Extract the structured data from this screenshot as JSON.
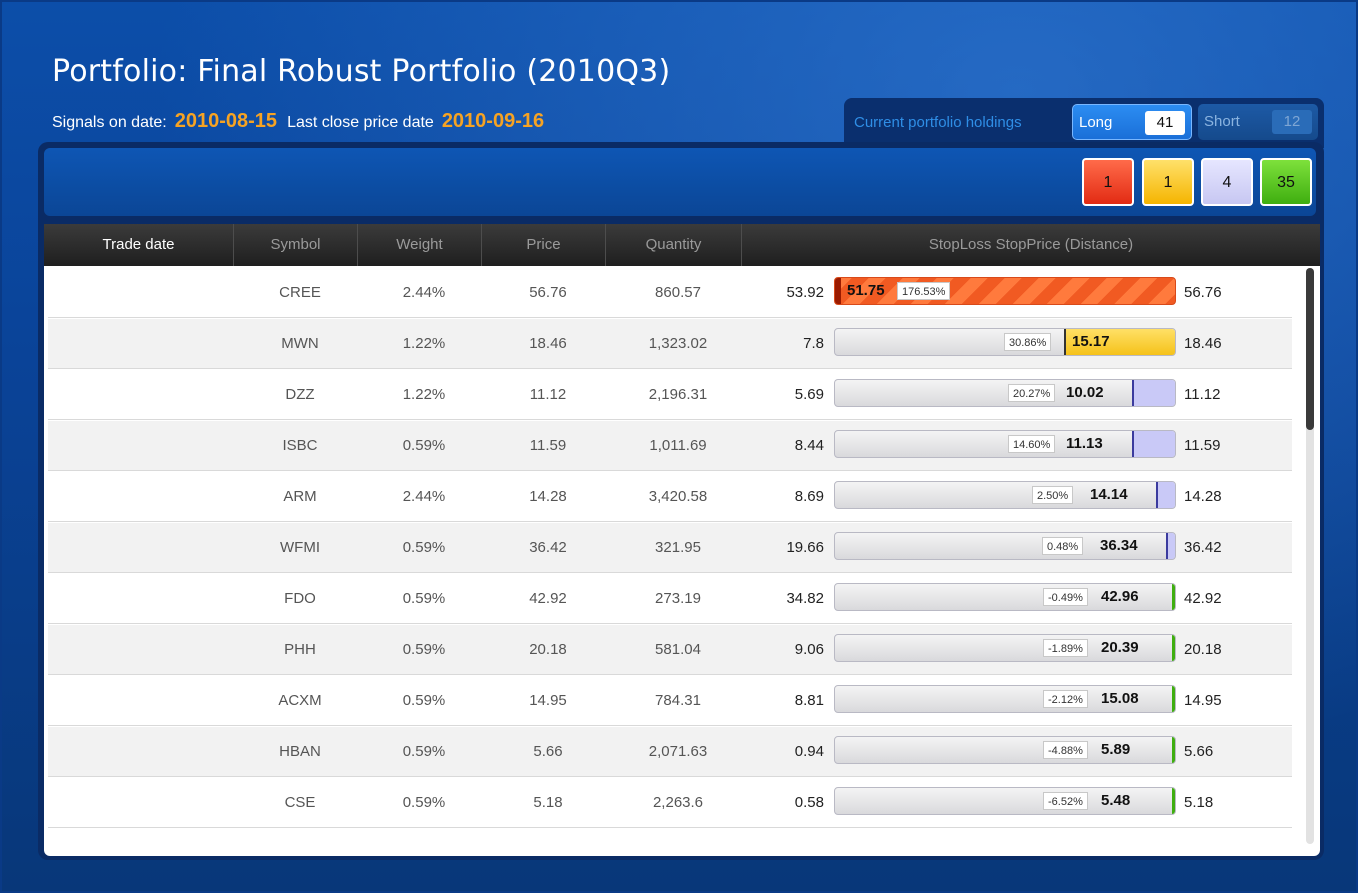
{
  "title": "Portfolio: Final Robust Portfolio (2010Q3)",
  "signals_label": "Signals on date:",
  "signals_date": "2010-08-15",
  "last_close_label": "Last close price date",
  "last_close_date": "2010-09-16",
  "holdings": {
    "label": "Current portfolio holdings",
    "long_label": "Long",
    "long_count": "41",
    "short_label": "Short",
    "short_count": "12"
  },
  "filters": {
    "red": "1",
    "yellow": "1",
    "lavender": "4",
    "green": "35"
  },
  "columns": [
    "Trade date",
    "Symbol",
    "Weight",
    "Price",
    "Quantity",
    "StopLoss StopPrice (Distance)"
  ],
  "rows": [
    {
      "symbol": "CREE",
      "weight": "2.44%",
      "price": "56.76",
      "qty": "860.57",
      "stop": "53.92",
      "stop_price": "51.75",
      "dist": "176.53%",
      "cur": "56.76",
      "status": "red"
    },
    {
      "symbol": "MWN",
      "weight": "1.22%",
      "price": "18.46",
      "qty": "1,323.02",
      "stop": "7.8",
      "stop_price": "15.17",
      "dist": "30.86%",
      "cur": "18.46",
      "status": "yellow",
      "fill": 0.32
    },
    {
      "symbol": "DZZ",
      "weight": "1.22%",
      "price": "11.12",
      "qty": "2,196.31",
      "stop": "5.69",
      "stop_price": "10.02",
      "dist": "20.27%",
      "cur": "11.12",
      "status": "lavender",
      "fill": 0.12
    },
    {
      "symbol": "ISBC",
      "weight": "0.59%",
      "price": "11.59",
      "qty": "1,011.69",
      "stop": "8.44",
      "stop_price": "11.13",
      "dist": "14.60%",
      "cur": "11.59",
      "status": "lavender",
      "fill": 0.12
    },
    {
      "symbol": "ARM",
      "weight": "2.44%",
      "price": "14.28",
      "qty": "3,420.58",
      "stop": "8.69",
      "stop_price": "14.14",
      "dist": "2.50%",
      "cur": "14.28",
      "status": "lavender",
      "fill": 0.05
    },
    {
      "symbol": "WFMI",
      "weight": "0.59%",
      "price": "36.42",
      "qty": "321.95",
      "stop": "19.66",
      "stop_price": "36.34",
      "dist": "0.48%",
      "cur": "36.42",
      "status": "lavender",
      "fill": 0.02
    },
    {
      "symbol": "FDO",
      "weight": "0.59%",
      "price": "42.92",
      "qty": "273.19",
      "stop": "34.82",
      "stop_price": "42.96",
      "dist": "-0.49%",
      "cur": "42.92",
      "status": "green"
    },
    {
      "symbol": "PHH",
      "weight": "0.59%",
      "price": "20.18",
      "qty": "581.04",
      "stop": "9.06",
      "stop_price": "20.39",
      "dist": "-1.89%",
      "cur": "20.18",
      "status": "green"
    },
    {
      "symbol": "ACXM",
      "weight": "0.59%",
      "price": "14.95",
      "qty": "784.31",
      "stop": "8.81",
      "stop_price": "15.08",
      "dist": "-2.12%",
      "cur": "14.95",
      "status": "green"
    },
    {
      "symbol": "HBAN",
      "weight": "0.59%",
      "price": "5.66",
      "qty": "2,071.63",
      "stop": "0.94",
      "stop_price": "5.89",
      "dist": "-4.88%",
      "cur": "5.66",
      "status": "green"
    },
    {
      "symbol": "CSE",
      "weight": "0.59%",
      "price": "5.18",
      "qty": "2,263.6",
      "stop": "0.58",
      "stop_price": "5.48",
      "dist": "-6.52%",
      "cur": "5.18",
      "status": "green"
    }
  ],
  "colors": {
    "accent": "#f6a323",
    "red": "#f15a22",
    "yellow": "#f5c21a",
    "lavender": "#c9c9f7",
    "green": "#3fae10"
  }
}
